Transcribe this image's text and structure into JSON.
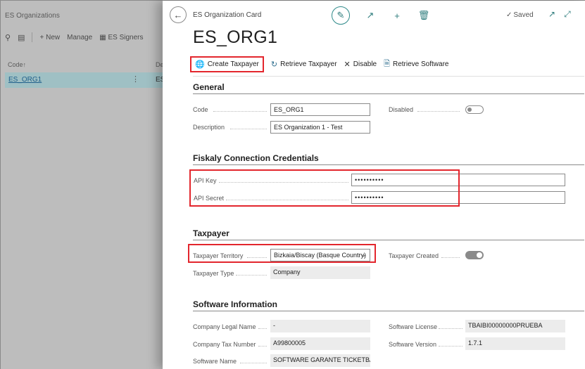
{
  "list_page": {
    "title": "ES Organizations",
    "toolbar": {
      "new_label": "New",
      "manage_label": "Manage",
      "signers_label": "ES Signers"
    },
    "column_code": "Code",
    "column_2": "De",
    "row": {
      "code": "ES_ORG1",
      "col2": "ES"
    }
  },
  "card": {
    "caption": "ES Organization Card",
    "saved_label": "Saved",
    "title": "ES_ORG1",
    "actions": [
      {
        "label": "Create Taxpayer",
        "icon": "globe-icon"
      },
      {
        "label": "Retrieve Taxpayer",
        "icon": "refresh-icon"
      },
      {
        "label": "Disable",
        "icon": "x-icon"
      },
      {
        "label": "Retrieve Software",
        "icon": "document-icon"
      }
    ],
    "general": {
      "title": "General",
      "code_label": "Code",
      "code_value": "ES_ORG1",
      "description_label": "Description",
      "description_value": "ES Organization 1 - Test",
      "disabled_label": "Disabled",
      "disabled_value": false
    },
    "credentials": {
      "title": "Fiskaly Connection Credentials",
      "api_key_label": "API Key",
      "api_key_value": "••••••••••",
      "api_secret_label": "API Secret",
      "api_secret_value": "••••••••••"
    },
    "taxpayer": {
      "title": "Taxpayer",
      "territory_label": "Taxpayer Territory",
      "territory_value": "Bizkaia/Biscay (Basque Country)",
      "type_label": "Taxpayer Type",
      "type_value": "Company",
      "created_label": "Taxpayer Created",
      "created_value": true
    },
    "software": {
      "title": "Software Information",
      "legal_name_label": "Company Legal Name",
      "legal_name_value": "-",
      "tax_number_label": "Company Tax Number",
      "tax_number_value": "A99800005",
      "software_name_label": "Software Name",
      "software_name_value": "SOFTWARE GARANTE TICKETBA...",
      "license_label": "Software License",
      "license_value": "TBAIBI00000000PRUEBA",
      "version_label": "Software Version",
      "version_value": "1.7.1"
    }
  },
  "colors": {
    "accent": "#2f7d7d",
    "highlight_border": "#e3262d",
    "selected_row": "#9fc0c4"
  }
}
